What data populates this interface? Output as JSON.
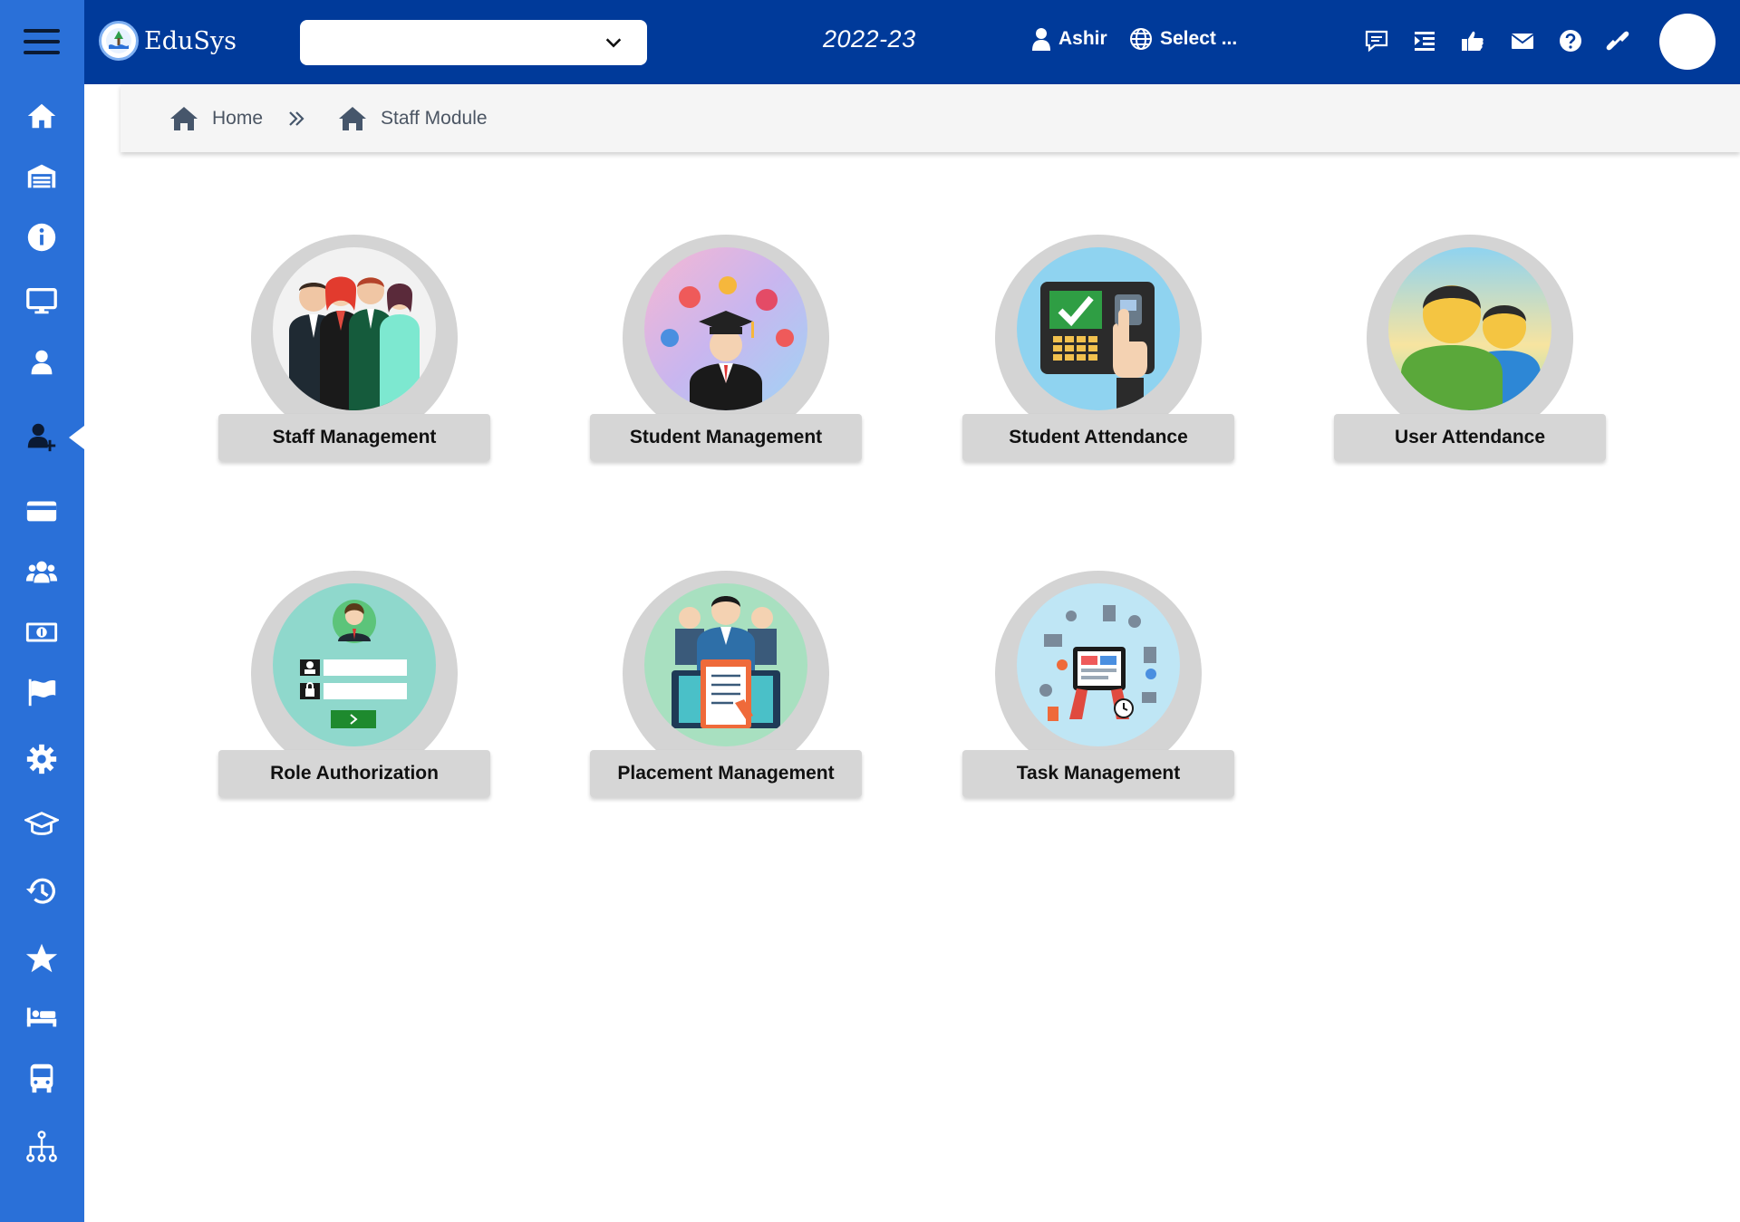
{
  "app": {
    "name": "EduSys"
  },
  "header": {
    "session_select_value": "",
    "academic_year": "2022-23",
    "user_name": "Ashir",
    "language_select": "Select ...",
    "icons": [
      "chat-icon",
      "indent-icon",
      "thumbs-up-icon",
      "mail-icon",
      "help-icon",
      "link-icon"
    ]
  },
  "sidebar": {
    "items": [
      "home-icon",
      "warehouse-icon",
      "info-icon",
      "monitor-icon",
      "user-icon",
      "user-add-icon",
      "card-icon",
      "users-icon",
      "money-icon",
      "flag-icon",
      "gear-icon",
      "graduation-cap-icon",
      "history-icon",
      "star-icon",
      "bed-icon",
      "bus-icon",
      "sitemap-icon"
    ],
    "active": "user-add-icon"
  },
  "breadcrumb": {
    "home": "Home",
    "current": "Staff Module"
  },
  "modules": [
    {
      "label": "Staff Management"
    },
    {
      "label": "Student Management"
    },
    {
      "label": "Student Attendance"
    },
    {
      "label": "User Attendance"
    },
    {
      "label": "Role Authorization"
    },
    {
      "label": "Placement Management"
    },
    {
      "label": "Task Management"
    }
  ],
  "colors": {
    "sidebar": "#2a70d8",
    "topbar": "#003a9a",
    "breadcrumb_bg": "#f5f5f5",
    "card_label_bg": "#d6d6d6"
  }
}
